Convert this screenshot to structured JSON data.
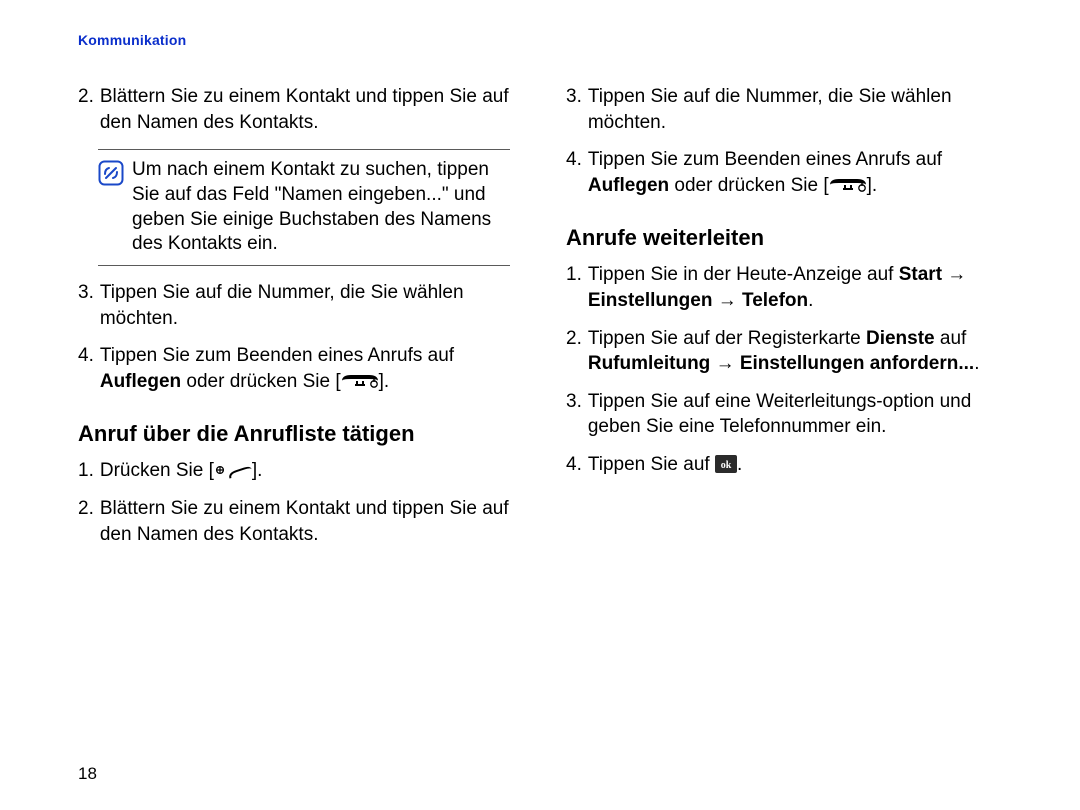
{
  "running_head": "Kommunikation",
  "page_number": "18",
  "left": {
    "top_list": [
      {
        "n": "2.",
        "text": "Blättern Sie zu einem Kontakt und tippen Sie auf den Namen des Kontakts."
      },
      {
        "n": "3.",
        "text": "Tippen Sie auf die Nummer, die Sie wählen möchten."
      }
    ],
    "note": "Um nach einem Kontakt zu suchen, tippen Sie auf das Feld \"Namen eingeben...\" und geben Sie einige Buchstaben des Namens des Kontakts ein.",
    "item4_pre": "Tippen Sie zum Beenden eines Anrufs auf ",
    "item4_bold": "Auflegen",
    "item4_mid": " oder drücken Sie [",
    "item4_post": "].",
    "heading": "Anruf über die Anrufliste tätigen",
    "bottom_list": {
      "item1_pre": "Drücken Sie [",
      "item1_post": "].",
      "item2": "Blättern Sie zu einem Kontakt und tippen Sie auf den Namen des Kontakts."
    }
  },
  "right": {
    "top_list": {
      "item3": "Tippen Sie auf die Nummer, die Sie wählen möchten.",
      "item4_pre": "Tippen Sie zum Beenden eines Anrufs auf ",
      "item4_bold": "Auflegen",
      "item4_mid": " oder drücken Sie [",
      "item4_post": "]."
    },
    "heading": "Anrufe weiterleiten",
    "forward_list": {
      "item1_pre": "Tippen Sie in der Heute-Anzeige auf ",
      "item1_b1": "Start",
      "item1_arrow1": " → ",
      "item1_b2": "Einstellungen",
      "item1_arrow2": " → ",
      "item1_b3": "Telefon",
      "item1_post": ".",
      "item2_pre": "Tippen Sie auf der Registerkarte ",
      "item2_b1": "Dienste",
      "item2_mid1": " auf ",
      "item2_b2": "Rufumleitung",
      "item2_arrow": " → ",
      "item2_b3": "Einstellungen anfordern...",
      "item2_post": ".",
      "item3": "Tippen Sie auf eine Weiterleitungs-option und geben Sie eine Telefonnummer ein.",
      "item4_pre": "Tippen Sie auf ",
      "item4_post": "."
    }
  }
}
